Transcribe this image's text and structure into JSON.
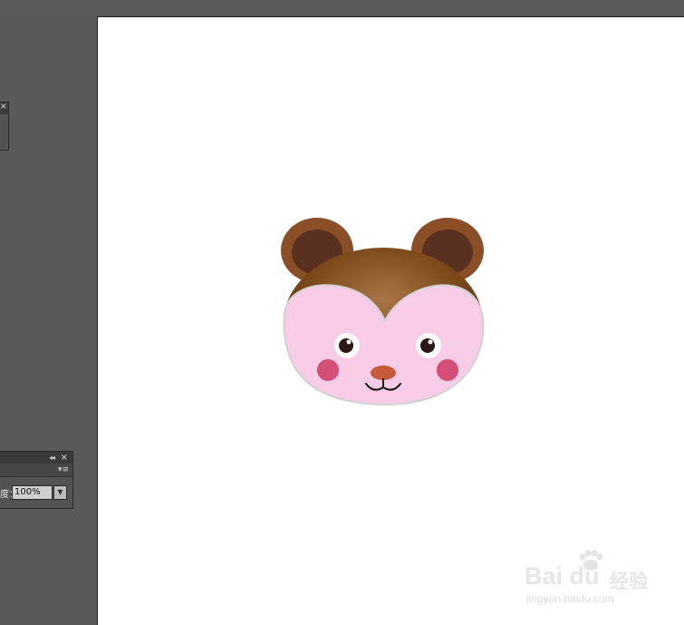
{
  "workspace": {
    "background": "#595959",
    "artboard_color": "#ffffff"
  },
  "mini_panel": {
    "close_icon": "×"
  },
  "panel": {
    "collapse_icon": "◂◂",
    "close_icon": "×",
    "menu_icon": "▾≡",
    "label": "度：",
    "value": "100%",
    "dropdown_icon": "▼"
  },
  "illustration": {
    "ear_color": "#8b4f27",
    "inner_ear_color": "#5a3120",
    "hair_color": "#7a4a1e",
    "face_color": "#f8cce6",
    "cheek_color": "#d44e76",
    "nose_color": "#c65a3a",
    "eye_color": "#2a1614"
  },
  "watermark": {
    "logo": "Bai du",
    "cn": "经验",
    "url": "jingyan.baidu.com"
  }
}
